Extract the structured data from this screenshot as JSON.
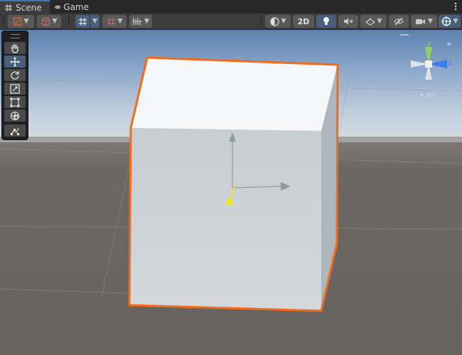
{
  "tabs": [
    {
      "label": "Scene",
      "icon": "hash-icon",
      "active": true
    },
    {
      "label": "Game",
      "icon": "gamepad-icon",
      "active": false
    }
  ],
  "toolbar": {
    "toggle_2d_label": "2D"
  },
  "tools": [
    "hand-tool",
    "move-tool",
    "rotate-tool",
    "scale-tool",
    "rect-tool",
    "transform-tool",
    "custom-tool"
  ],
  "colors": {
    "accent": "#3a79bb",
    "selection_outline": "#f26b1d",
    "sky_top": "#5c80b0",
    "horizon": "#d6dde6",
    "ground": "#6b6563",
    "gizmo_y": "#8dd35f",
    "gizmo_z": "#3b7cf0",
    "light_handle": "#f7e22a"
  }
}
